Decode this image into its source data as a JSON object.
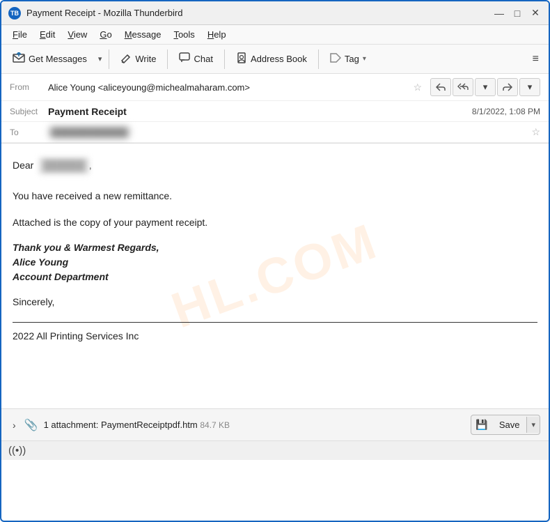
{
  "window": {
    "title": "Payment Receipt - Mozilla Thunderbird",
    "icon": "TB"
  },
  "titlebar": {
    "minimize": "—",
    "maximize": "□",
    "close": "✕"
  },
  "menubar": {
    "items": [
      {
        "label": "File",
        "underline": "F"
      },
      {
        "label": "Edit",
        "underline": "E"
      },
      {
        "label": "View",
        "underline": "V"
      },
      {
        "label": "Go",
        "underline": "G"
      },
      {
        "label": "Message",
        "underline": "M"
      },
      {
        "label": "Tools",
        "underline": "T"
      },
      {
        "label": "Help",
        "underline": "H"
      }
    ]
  },
  "toolbar": {
    "get_messages": "Get Messages",
    "write": "Write",
    "chat": "Chat",
    "address_book": "Address Book",
    "tag": "Tag"
  },
  "email": {
    "from_label": "From",
    "from_value": "Alice Young <aliceyoung@michealmaharam.com>",
    "subject_label": "Subject",
    "subject_value": "Payment Receipt",
    "date": "8/1/2022, 1:08 PM",
    "to_label": "To",
    "to_value": "██████████████"
  },
  "body": {
    "dear": "Dear",
    "dear_name": "██████",
    "paragraph1": "You have received a new remittance.",
    "paragraph2": "Attached is the copy of your payment receipt.",
    "closing_line1": "Thank you & Warmest Regards,",
    "closing_line2": "Alice Young",
    "closing_line3": "Account Department",
    "sincerely": "Sincerely,",
    "footer": "2022 All Printing Services Inc",
    "watermark": "HL.COM"
  },
  "attachment": {
    "count": "1 attachment:",
    "filename": "PaymentReceiptpdf.htm",
    "size": "84.7 KB",
    "save_label": "Save"
  },
  "statusbar": {
    "wifi_icon": "((•))"
  }
}
